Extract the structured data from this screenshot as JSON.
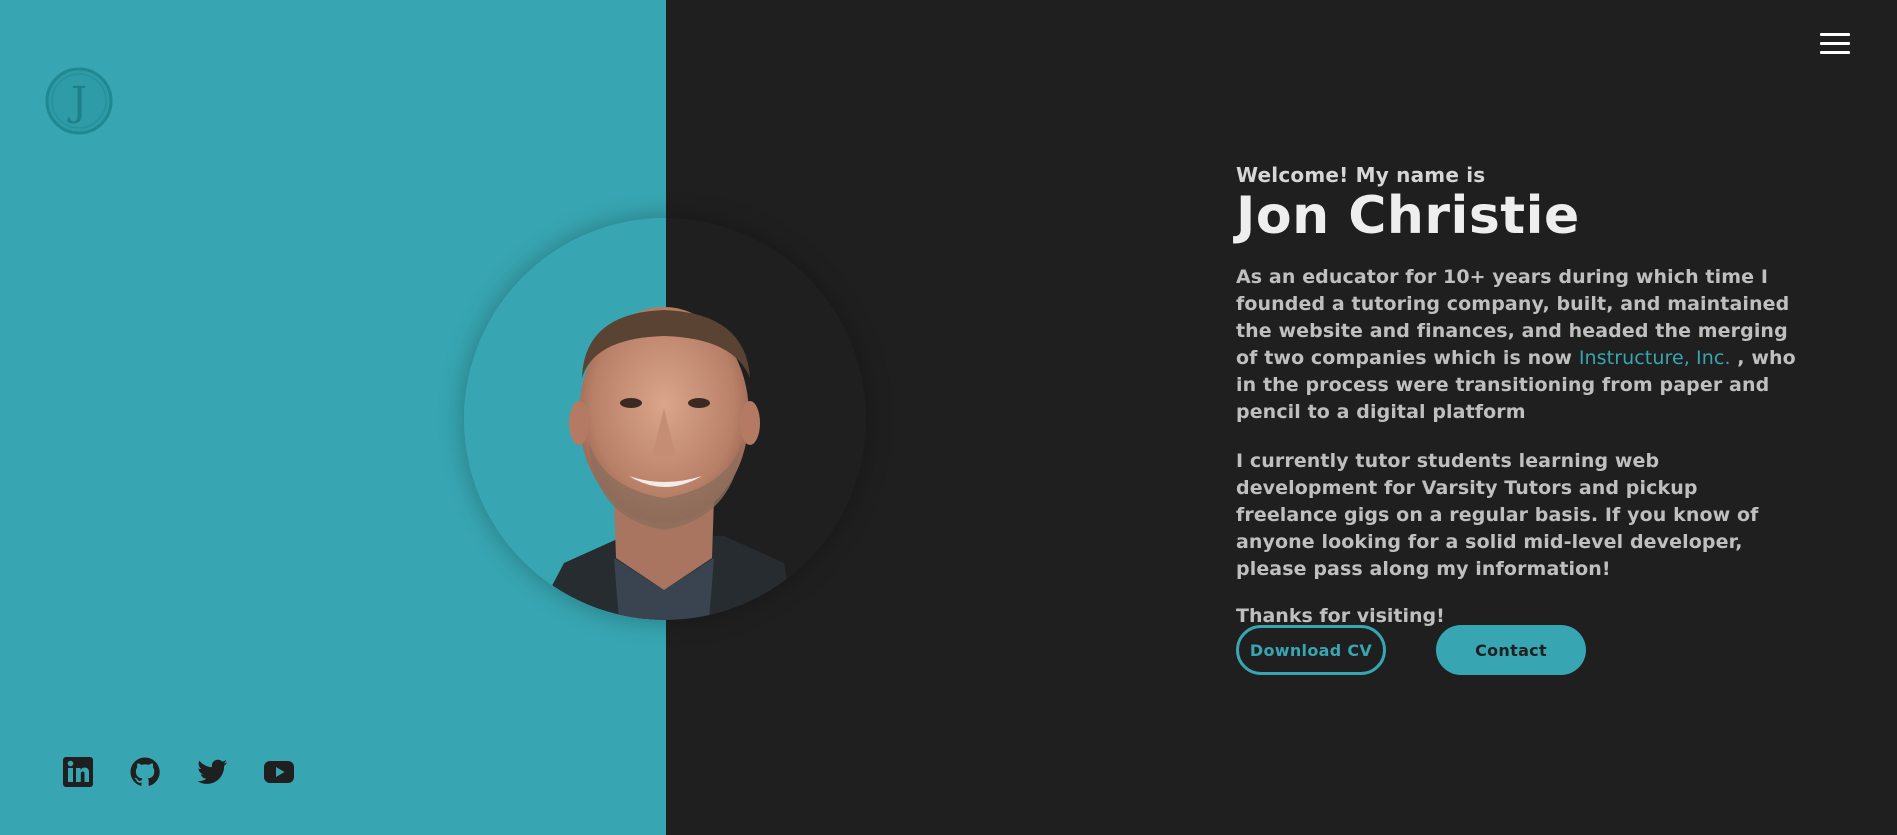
{
  "brand": {
    "logo_letter": "J"
  },
  "nav": {
    "menu_icon": "hamburger-menu-icon"
  },
  "hero": {
    "greeting": "Welcome! My name is",
    "name": "Jon Christie",
    "bio_1_before": "As an educator for 10+ years during which time I founded a tutoring company, built, and maintained the website and finances, and headed the merging of two companies which is now ",
    "bio_1_link": "Instructure, Inc.",
    "bio_1_after": " , who in the process were transitioning from paper and pencil to a digital platform",
    "bio_2": "I currently tutor students learning web development for Varsity Tutors and pickup freelance gigs on a regular basis. If you know of anyone looking for a solid mid-level developer, please pass along my information!",
    "thanks": "Thanks for visiting!"
  },
  "buttons": {
    "download_cv": "Download CV",
    "contact": "Contact"
  },
  "socials": [
    {
      "icon": "linkedin-icon"
    },
    {
      "icon": "github-icon"
    },
    {
      "icon": "twitter-icon"
    },
    {
      "icon": "youtube-icon"
    }
  ],
  "colors": {
    "accent": "#37a6b2",
    "background": "#1f1f1f",
    "text": "#bfbfbf"
  }
}
